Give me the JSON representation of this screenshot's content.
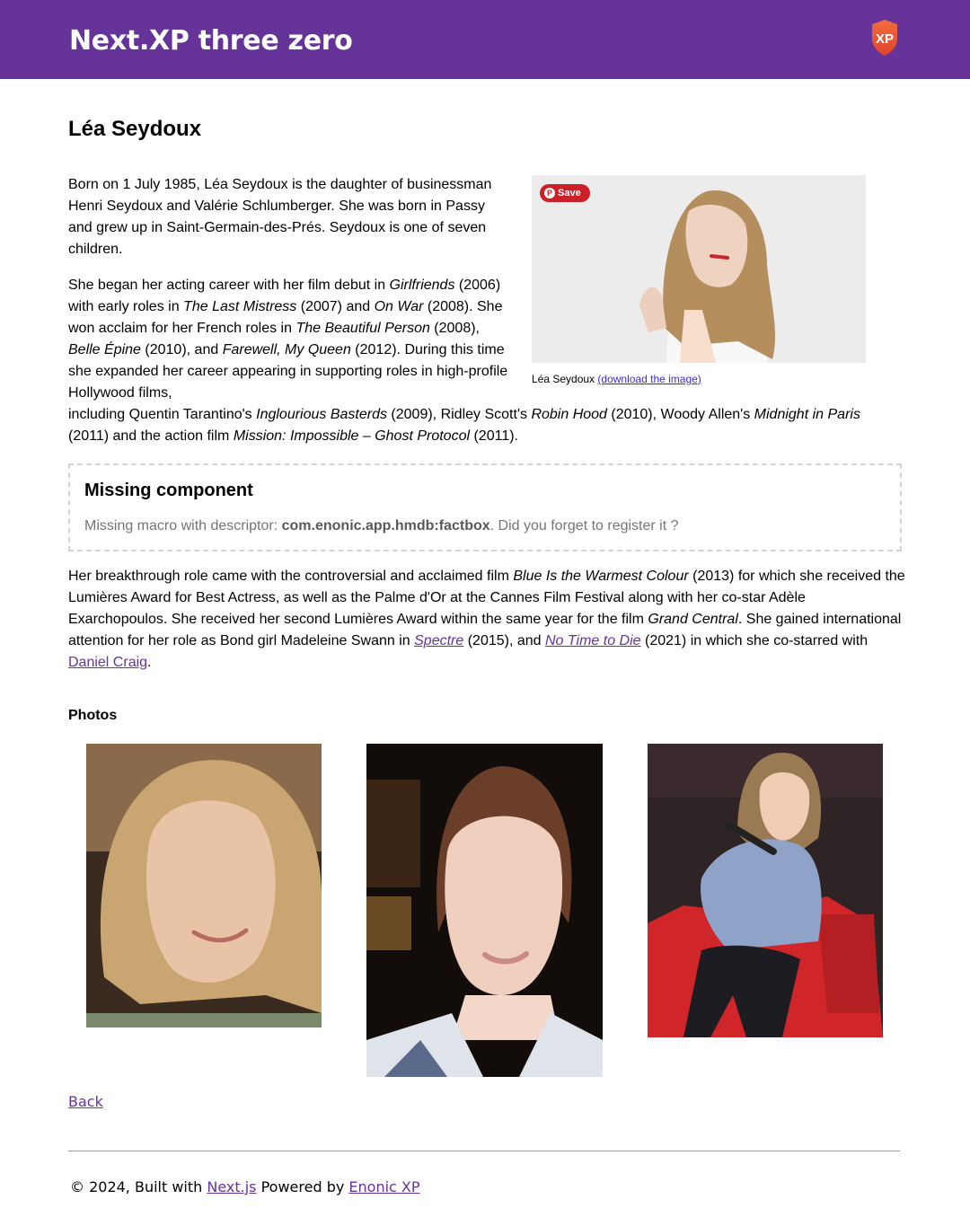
{
  "header": {
    "site_title": "Next.XP three zero",
    "logo_text": "XP",
    "brand_color": "#663399"
  },
  "article": {
    "title": "Léa Seydoux",
    "para1": {
      "text": "Born on 1 July 1985, Léa Seydoux is the daughter of businessman Henri Seydoux and Valérie Schlumberger. She was born in Passy and grew up in Saint-Germain-des-Prés. Seydoux is one of seven children."
    },
    "para2": {
      "t1": "She began her acting career with her film debut in ",
      "i1": "Girlfriends",
      "t2": " (2006) with early roles in ",
      "i2": "The Last Mistress",
      "t3": " (2007) and ",
      "i3": "On War",
      "t4": " (2008). She won acclaim for her French roles in ",
      "i4": "The Beautiful Person",
      "t5": " (2008), ",
      "i5": "Belle Épine",
      "t6": " (2010), and ",
      "i6": "Farewell, My Queen",
      "t7": " (2012). During this time she expanded her career appearing in supporting roles in high-profile Hollywood films,",
      "t8": "including Quentin Tarantino's ",
      "i7": "Inglourious Basterds",
      "t9": " (2009), Ridley Scott's ",
      "i8": "Robin Hood",
      "t10": " (2010), Woody Allen's ",
      "i9": "Midnight in Paris",
      "t11": " (2011) and the action film ",
      "i10": "Mission: Impossible – Ghost Protocol",
      "t12": " (2011)."
    },
    "figure": {
      "save_label": "Save",
      "pin_icon": "P",
      "caption": "Léa Seydoux",
      "download_link": "(download the image)"
    },
    "missing_component": {
      "title": "Missing component",
      "text_before": "Missing macro with descriptor: ",
      "descriptor": "com.enonic.app.hmdb:factbox",
      "text_after": ". Did you forget to register it ?"
    },
    "para3": {
      "t1": "Her breakthrough role came with the controversial and acclaimed film ",
      "i1": "Blue Is the Warmest Colour",
      "t2": " (2013) for which she received the Lumières Award for Best Actress, as well as the Palme d'Or at the Cannes Film Festival along with her co-star Adèle Exarchopoulos. She received her second Lumières Award within the same year for the film ",
      "i2": "Grand Central",
      "t3": ". She gained international attention for her role as Bond girl Madeleine Swann in ",
      "link1": "Spectre",
      "t4": " (2015), and ",
      "link2": "No Time to Die",
      "t5": " (2021) in which she co-starred with ",
      "link3": "Daniel Craig",
      "t6": "."
    }
  },
  "photos": {
    "heading": "Photos"
  },
  "nav": {
    "back_label": "Back"
  },
  "footer": {
    "prefix": "© 2024, Built with ",
    "link1": "Next.js",
    "middle": " Powered by ",
    "link2": "Enonic XP"
  }
}
